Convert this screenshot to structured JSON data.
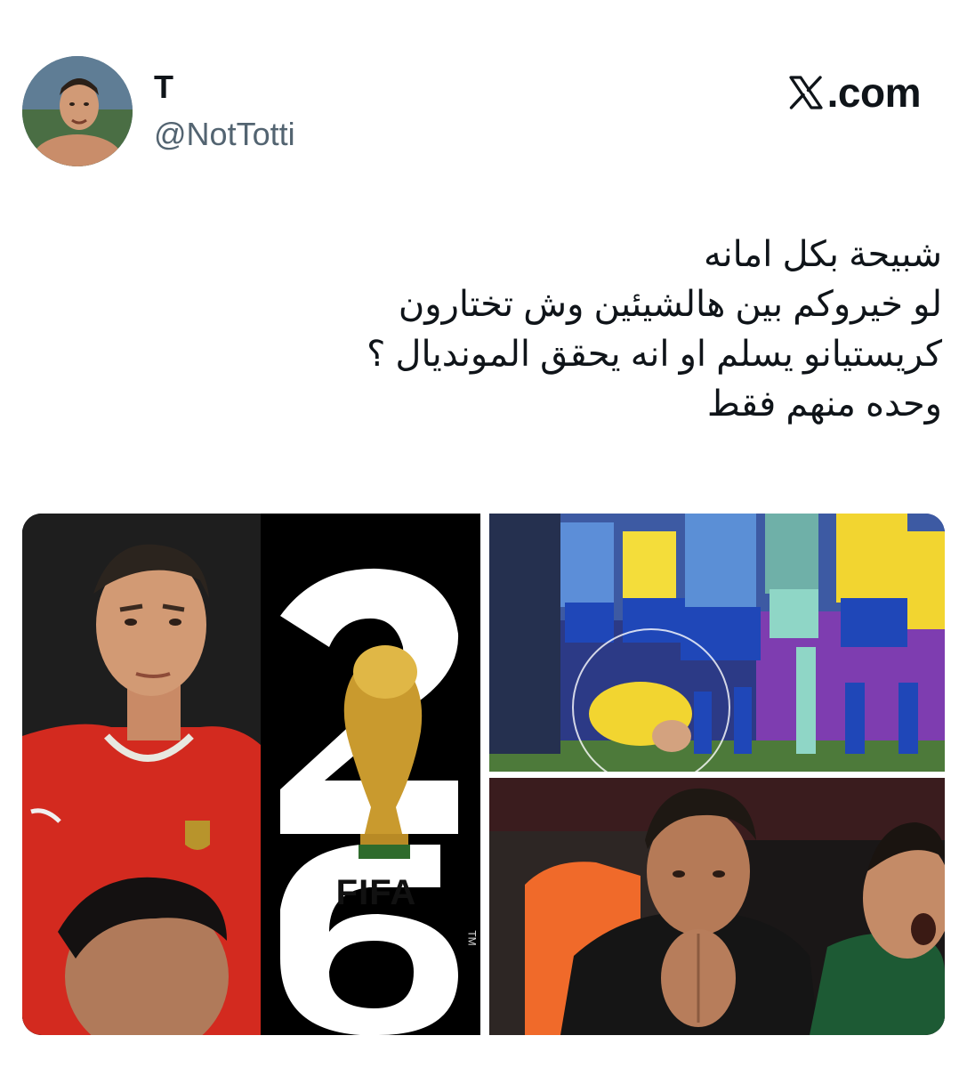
{
  "author": {
    "display_name": "T",
    "handle": "@NotTotti",
    "avatar_icon": "profile-photo"
  },
  "brand": {
    "label": ".com",
    "logo_icon": "x-logo-icon"
  },
  "tweet": {
    "lines": [
      "شبيحة بكل امانه",
      "لو خيروكم بين هالشيئين وش تختارون",
      "كريستيانو يسلم او انه يحقق المونديال ؟",
      "وحده منهم فقط"
    ]
  },
  "media": {
    "images": [
      {
        "name": "ronaldo-portugal-and-world-cup-26-logo",
        "caption_text": "FIFA",
        "tm": "TM"
      },
      {
        "name": "ronaldo-prostration-celebration"
      },
      {
        "name": "ronaldo-praying-hands"
      }
    ]
  },
  "colors": {
    "text": "#0f1419",
    "secondary_text": "#536471",
    "background": "#ffffff"
  }
}
